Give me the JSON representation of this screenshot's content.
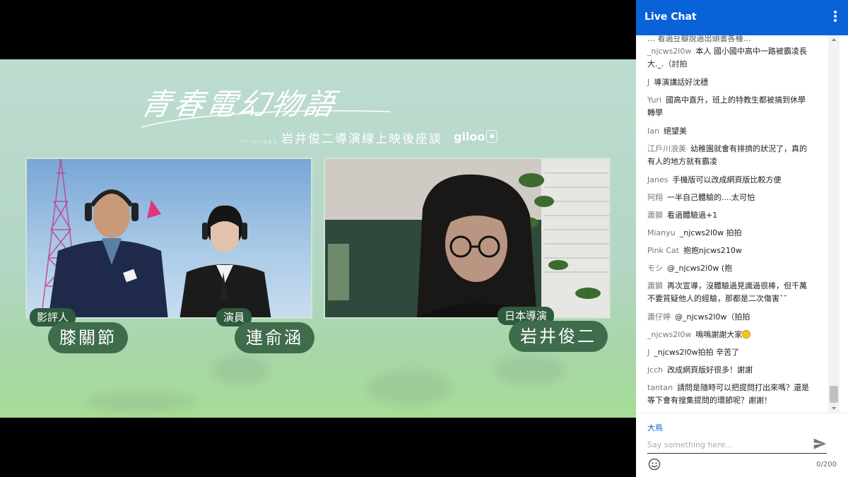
{
  "event": {
    "film_title": "青春電幻物語",
    "film_subtitle": "ﾘﾘｲ･ｼｭｼｭの全て",
    "talk_title": "岩井俊二導演線上映後座談",
    "brand": "giloo"
  },
  "speakers": [
    {
      "role": "影評人",
      "name": "膝關節"
    },
    {
      "role": "演員",
      "name": "連俞涵"
    },
    {
      "role": "日本導演",
      "name": "岩井俊二"
    }
  ],
  "chat": {
    "title": "Live Chat",
    "truncated_top": "… 看過豆瓣說過出頭書各種…",
    "messages": [
      {
        "user": "_njcws2l0w",
        "text": "本人 國小國中高中一路被霸凌長大._.（討拍"
      },
      {
        "user": "J",
        "text": "導演講話好沈穩"
      },
      {
        "user": "Yuri",
        "text": "國高中直升，班上的特教生都被搞到休學轉學"
      },
      {
        "user": "Ian",
        "text": "絕望美"
      },
      {
        "user": "江戶川浪美",
        "text": "幼稚園就會有排擠的狀況了，真的有人的地方就有霸凌"
      },
      {
        "user": "Janes",
        "text": "手機版可以改成網頁版比較方便"
      },
      {
        "user": "阿翔",
        "text": "一半自己體驗的....太可怕"
      },
      {
        "user": "蕭鎖",
        "text": "看過體驗過+1"
      },
      {
        "user": "Mianyu",
        "text": "_njcws2l0w 拍拍"
      },
      {
        "user": "Pink Cat",
        "text": "抱抱njcws210w"
      },
      {
        "user": "モシ",
        "text": "@_njcws2l0w (抱"
      },
      {
        "user": "蕭鎖",
        "text": "再次宣導，沒體驗過見識過很棒，但千萬不要質疑他人的經驗，那都是二次傷害ˇˇ"
      },
      {
        "user": "蕭仔婷",
        "text": "@_njcws2l0w（拍拍"
      },
      {
        "user": "_njcws2l0w",
        "text": "嗚嗚謝謝大家",
        "emoji": "crying-face"
      },
      {
        "user": "J",
        "text": "_njcws2l0w拍拍 辛苦了"
      },
      {
        "user": "jcch",
        "text": "改成網頁版好很多！謝謝"
      },
      {
        "user": "tantan",
        "text": "請問是隨時可以把提問打出來嗎？還是等下會有搜集提問的環節呢？謝謝！"
      }
    ],
    "current_user": "大鳥",
    "input_placeholder": "Say something here...",
    "char_count": "0/200"
  },
  "colors": {
    "chat_header": "#0a62d8",
    "name_tag": "#3f6c4b",
    "stage_bg": "#b4d6c6"
  },
  "icons": [
    "more-vert-icon",
    "send-icon",
    "emoji-icon",
    "scroll-up-icon",
    "scroll-down-icon"
  ]
}
